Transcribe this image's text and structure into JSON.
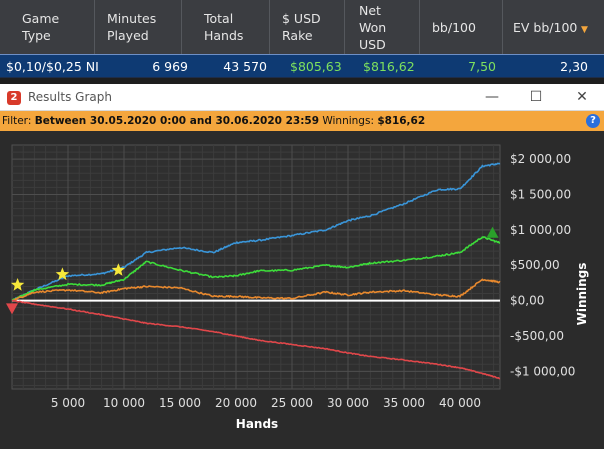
{
  "stats": {
    "headers": [
      "Game\nType",
      "Minutes\nPlayed",
      "Total\nHands",
      "$ USD\nRake",
      "Net\nWon\nUSD",
      "bb/100",
      "EV bb/100"
    ],
    "row": {
      "game_type": "$0,10/$0,25 NI",
      "minutes_played": "6 969",
      "total_hands": "43 570",
      "rake": "$805,63",
      "net_won": "$816,62",
      "bb100": "7,50",
      "ev_bb100": "2,30"
    }
  },
  "window": {
    "title": "Results Graph",
    "icon_label": "2",
    "controls": [
      "minimize",
      "maximize",
      "close"
    ]
  },
  "filter": {
    "label": "Filter:",
    "range": "Between 30.05.2020 0:00 and 30.06.2020 23:59",
    "winnings_label": "Winnings:",
    "winnings_value": "$816,62"
  },
  "colors": {
    "header_bg": "#3b3d41",
    "row_bg": "#0e3a73",
    "positive_green": "#7ee05e",
    "filter_bg": "#f4a63d",
    "plot_bg": "#2b2b2b",
    "grid": "#4a4a4a",
    "series_blue": "#3a95d8",
    "series_green": "#3ddc3a",
    "series_orange": "#e8892e",
    "series_red": "#e0474a"
  },
  "chart_data": {
    "type": "line",
    "xlabel": "Hands",
    "ylabel": "Winnings",
    "xlim": [
      0,
      43570
    ],
    "ylim": [
      -1250,
      2200
    ],
    "x_ticks": [
      5000,
      10000,
      15000,
      20000,
      25000,
      30000,
      35000,
      40000
    ],
    "x_tick_labels": [
      "5 000",
      "10 000",
      "15 000",
      "20 000",
      "25 000",
      "30 000",
      "35 000",
      "40 000"
    ],
    "y_ticks": [
      2000,
      1500,
      1000,
      500,
      0,
      -500,
      -1000
    ],
    "y_tick_labels": [
      "$2 000,00",
      "$1 500,00",
      "$1 000,00",
      "$500,00",
      "$0,00",
      "-$500,00",
      "-$1 000,00"
    ],
    "grid": true,
    "x": [
      0,
      2000,
      5000,
      8000,
      10000,
      12000,
      15000,
      18000,
      20000,
      22000,
      25000,
      28000,
      30000,
      32000,
      35000,
      38000,
      40000,
      42000,
      43570
    ],
    "series": [
      {
        "color": "#3a95d8",
        "values": [
          0,
          150,
          350,
          380,
          470,
          680,
          750,
          680,
          820,
          850,
          920,
          1000,
          1130,
          1200,
          1370,
          1570,
          1580,
          1900,
          1940
        ]
      },
      {
        "color": "#3ddc3a",
        "values": [
          0,
          150,
          230,
          220,
          300,
          550,
          430,
          330,
          350,
          420,
          430,
          500,
          470,
          530,
          570,
          630,
          680,
          900,
          816
        ]
      },
      {
        "color": "#e8892e",
        "values": [
          0,
          120,
          150,
          110,
          170,
          200,
          180,
          60,
          60,
          40,
          30,
          120,
          80,
          120,
          140,
          80,
          60,
          300,
          260
        ]
      },
      {
        "color": "#e0474a",
        "values": [
          0,
          -50,
          -120,
          -200,
          -260,
          -320,
          -370,
          -440,
          -500,
          -560,
          -620,
          -680,
          -740,
          -790,
          -840,
          -900,
          -950,
          -1030,
          -1100
        ]
      }
    ],
    "markers": [
      {
        "shape": "star",
        "color": "#f6e83a",
        "x": 500,
        "y": 220
      },
      {
        "shape": "star",
        "color": "#f6e83a",
        "x": 4500,
        "y": 370
      },
      {
        "shape": "star",
        "color": "#f6e83a",
        "x": 9500,
        "y": 430
      },
      {
        "shape": "triangle-down",
        "color": "#e0474a",
        "x": 0,
        "y": -110
      },
      {
        "shape": "triangle-up",
        "color": "#2aa02a",
        "x": 42900,
        "y": 960
      }
    ]
  }
}
